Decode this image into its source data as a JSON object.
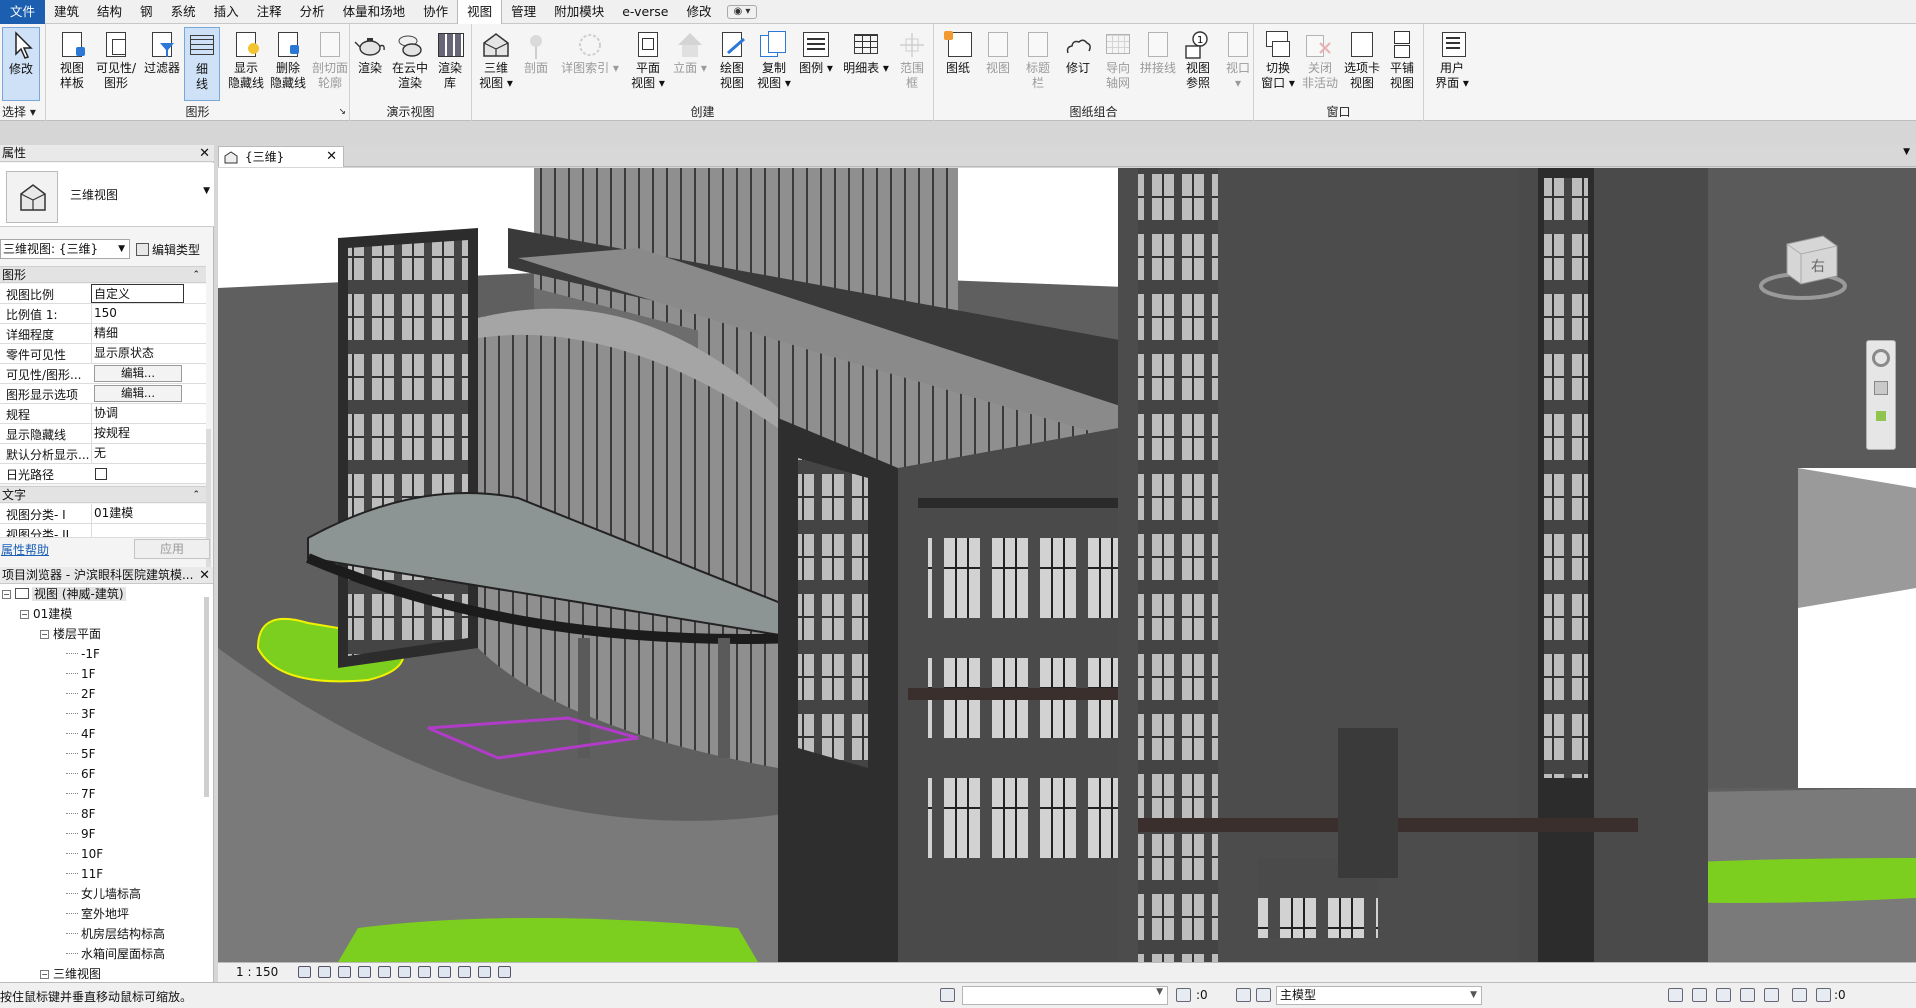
{
  "menubar": {
    "tabs": [
      "文件",
      "建筑",
      "结构",
      "钢",
      "系统",
      "插入",
      "注释",
      "分析",
      "体量和场地",
      "协作",
      "视图",
      "管理",
      "附加模块",
      "e-verse",
      "修改"
    ],
    "active_tab": "视图"
  },
  "ribbon": {
    "groups": {
      "select": "选择",
      "graphics": "图形",
      "presentation": "演示视图",
      "create": "创建",
      "sheet": "图纸组合",
      "window": "窗口"
    },
    "buttons": {
      "modify": "修改",
      "view_template": [
        "视图",
        "样板"
      ],
      "visibility": [
        "可见性/",
        "图形"
      ],
      "filters": "过滤器",
      "thin_lines": [
        "细",
        "线"
      ],
      "show_hidden": [
        "显示",
        "隐藏线"
      ],
      "remove_hidden": [
        "删除",
        "隐藏线"
      ],
      "cut_profile": [
        "剖切面",
        "轮廓"
      ],
      "render": "渲染",
      "render_cloud": [
        "在云中",
        "渲染"
      ],
      "render_gallery": [
        "渲染",
        "库"
      ],
      "view_3d": [
        "三维",
        "视图"
      ],
      "section": "剖面",
      "callout": "详图索引",
      "plan_views": [
        "平面",
        "视图"
      ],
      "elevation": "立面",
      "drafting_view": [
        "绘图",
        "视图"
      ],
      "duplicate_view": [
        "复制",
        "视图"
      ],
      "legends": "图例",
      "schedules": "明细表",
      "scope_box": [
        "范围",
        "框"
      ],
      "sheet": "图纸",
      "view": "视图",
      "title_block": [
        "标题",
        "栏"
      ],
      "revisions": "修订",
      "guide_grid": [
        "导向",
        "轴网"
      ],
      "matchline": "拼接线",
      "view_reference": [
        "视图",
        "参照"
      ],
      "viewports": "视口",
      "switch_windows": [
        "切换",
        "窗口"
      ],
      "close_inactive": [
        "关闭",
        "非活动"
      ],
      "tab_views": [
        "选项卡",
        "视图"
      ],
      "tile_views": [
        "平铺",
        "视图"
      ],
      "user_interface": [
        "用户",
        "界面"
      ]
    }
  },
  "properties": {
    "title": "属性",
    "type_name": "三维视图",
    "view_selector": "三维视图: {三维}",
    "edit_type": "编辑类型",
    "sections": {
      "graphics": "图形",
      "text": "文字"
    },
    "rows": [
      {
        "key": "视图比例",
        "value": "自定义"
      },
      {
        "key": "比例值 1:",
        "value": "150"
      },
      {
        "key": "详细程度",
        "value": "精细"
      },
      {
        "key": "零件可见性",
        "value": "显示原状态"
      },
      {
        "key": "可见性/图形...",
        "value": "编辑..."
      },
      {
        "key": "图形显示选项",
        "value": "编辑..."
      },
      {
        "key": "规程",
        "value": "协调"
      },
      {
        "key": "显示隐藏线",
        "value": "按规程"
      },
      {
        "key": "默认分析显示...",
        "value": "无"
      },
      {
        "key": "日光路径",
        "value": ""
      }
    ],
    "text_rows": [
      {
        "key": "视图分类- I",
        "value": "01建模"
      },
      {
        "key": "视图分类- II",
        "value": ""
      }
    ],
    "help": "属性帮助",
    "apply": "应用"
  },
  "browser": {
    "title": "项目浏览器 - 沪滨眼科医院建筑模...",
    "root": "视图 (神威-建筑)",
    "group": "01建模",
    "subgroup": "楼层平面",
    "levels": [
      "-1F",
      "1F",
      "2F",
      "3F",
      "4F",
      "5F",
      "6F",
      "7F",
      "8F",
      "9F",
      "10F",
      "11F",
      "女儿墙标高",
      "室外地坪",
      "机房层结构标高",
      "水箱间屋面标高"
    ],
    "next_group": "三维视图"
  },
  "view_tab": {
    "label": "{三维}"
  },
  "viewcube": {
    "face": "右"
  },
  "view_control": {
    "scale": "1 : 150"
  },
  "status": {
    "message": "按住鼠标键并垂直移动鼠标可缩放。",
    "filter_count": ":0",
    "model": "主模型",
    "select_count": ":0"
  }
}
